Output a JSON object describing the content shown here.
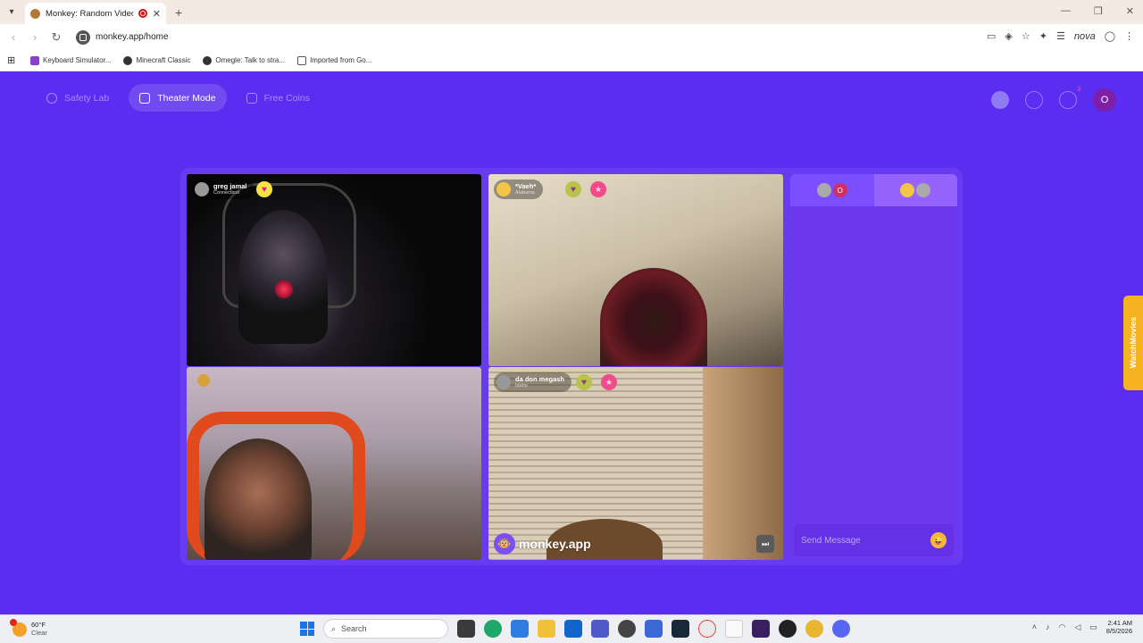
{
  "browser": {
    "tab_title": "Monkey: Random Video Ch",
    "url": "monkey.app/home",
    "profile_name": "nova",
    "bookmarks": [
      {
        "label": "Keyboard Simulator..."
      },
      {
        "label": "Minecraft Classic"
      },
      {
        "label": "Omegle: Talk to stra..."
      },
      {
        "label": "Imported from Go..."
      }
    ]
  },
  "nav": {
    "safety_lab": "Safety Lab",
    "theater_mode": "Theater Mode",
    "free_coins": "Free Coins",
    "notification_count": "3",
    "profile_initial": "O"
  },
  "videos": {
    "tile1": {
      "name": "greg jamal",
      "location": "Connecticut"
    },
    "tile2": {
      "name": "*Vaeh*",
      "location": "Alabama"
    },
    "tile4": {
      "name": "da don megash",
      "location": "Idaho"
    },
    "watermark": "monkey.app"
  },
  "chat": {
    "tab1_badge": "O",
    "input_placeholder": "Send Message"
  },
  "side_tab": {
    "label": "WatchMovies"
  },
  "taskbar": {
    "temperature": "60°F",
    "condition": "Clear",
    "search_label": "Search",
    "time": "2:41 AM",
    "date": "8/5/2026"
  },
  "colors": {
    "accent": "#5b2df0",
    "chat_bg": "#6e38ef",
    "side_tab": "#f5b321"
  }
}
